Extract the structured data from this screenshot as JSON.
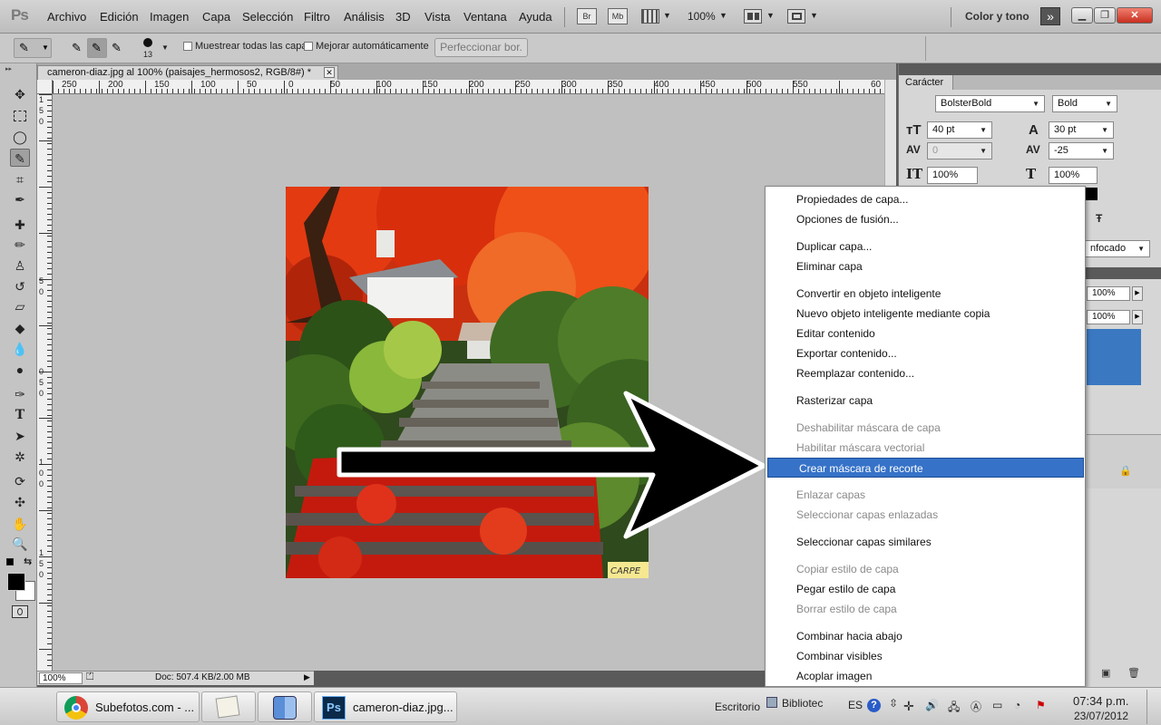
{
  "app": {
    "logo": "Ps",
    "workspace": "Color y tono"
  },
  "menu": [
    "Archivo",
    "Edición",
    "Imagen",
    "Capa",
    "Selección",
    "Filtro",
    "Análisis",
    "3D",
    "Vista",
    "Ventana",
    "Ayuda"
  ],
  "appbar": {
    "bridge": "Br",
    "mini_bridge": "Mb",
    "zoom": "100%"
  },
  "options": {
    "brush_size": "13",
    "sample_all": "Muestrear todas las capas",
    "auto_enhance": "Mejorar automáticamente",
    "refine": "Perfeccionar bor."
  },
  "document": {
    "tab": "cameron-diaz.jpg al 100% (paisajes_hermosos2, RGB/8#) *",
    "zoom": "100%",
    "doc_size": "Doc: 507.4 KB/2.00 MB"
  },
  "ruler_h": [
    "250",
    "200",
    "150",
    "100",
    "50",
    "0",
    "50",
    "100",
    "150",
    "200",
    "250",
    "300",
    "350",
    "400",
    "450",
    "500",
    "550",
    "60"
  ],
  "ruler_v": [
    "1",
    "5",
    "0",
    "5",
    "0",
    "0",
    "5",
    "0",
    "1",
    "0",
    "0",
    "1",
    "5",
    "0",
    "2",
    "0",
    "0",
    "2",
    "5",
    "0",
    "3",
    "0",
    "0",
    "3",
    "5",
    "0",
    "4",
    "0",
    "0"
  ],
  "photo": {
    "watermark": "CARPE"
  },
  "character_panel": {
    "tab": "Carácter",
    "font_family": "BolsterBold",
    "font_style": "Bold",
    "size": "40 pt",
    "leading": "30 pt",
    "kerning": "0",
    "tracking": "-25",
    "vscale": "100%",
    "hscale": "100%",
    "antialias": "nfocado",
    "opacity": "100%",
    "fill": "100%"
  },
  "context_menu": {
    "items": [
      "Propiedades de capa...",
      "Opciones de fusión...",
      "Duplicar capa...",
      "Eliminar capa",
      "Convertir en objeto inteligente",
      "Nuevo objeto inteligente mediante copia",
      "Editar contenido",
      "Exportar contenido...",
      "Reemplazar contenido...",
      "Rasterizar capa",
      "Deshabilitar máscara de capa",
      "Habilitar máscara vectorial",
      "Crear máscara de recorte",
      "Enlazar capas",
      "Seleccionar capas enlazadas",
      "Seleccionar capas similares",
      "Copiar estilo de capa",
      "Pegar estilo de capa",
      "Borrar estilo de capa",
      "Combinar hacia abajo",
      "Combinar visibles",
      "Acoplar imagen"
    ],
    "highlighted": "Crear máscara de recorte"
  },
  "taskbar": {
    "tasks": [
      "Subefotos.com - ...",
      "cameron-diaz.jpg..."
    ],
    "desktop": "Escritorio",
    "library": "Bibliotec",
    "lang": "ES",
    "time": "07:34 p.m.",
    "date": "23/07/2012"
  },
  "colors": {
    "highlight": "#3672c8",
    "panel_selected": "#3a78c2",
    "ui_gray": "#c9c9c9"
  }
}
